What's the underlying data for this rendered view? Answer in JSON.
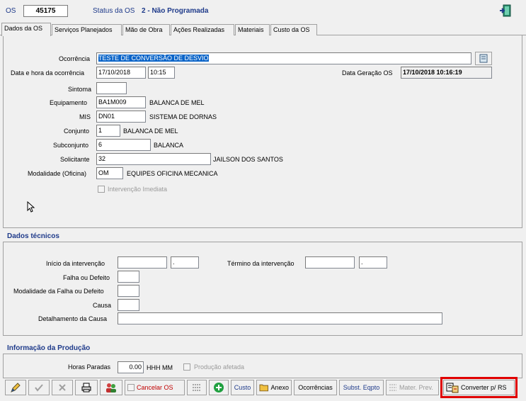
{
  "header": {
    "os_label": "OS",
    "os_number": "45175",
    "status_label": "Status da OS",
    "status_value": "2 - Não Programada"
  },
  "tabs": [
    {
      "label": "Dados da OS",
      "active": true
    },
    {
      "label": "Serviços Planejados",
      "active": false
    },
    {
      "label": "Mão de Obra",
      "active": false
    },
    {
      "label": "Ações Realizadas",
      "active": false
    },
    {
      "label": "Materiais",
      "active": false
    },
    {
      "label": "Custo da OS",
      "active": false
    }
  ],
  "form": {
    "ocorrencia_label": "Ocorrência",
    "ocorrencia_value": "TESTE DE CONVERSÃO DE DESVIO",
    "data_hora_label": "Data e hora da ocorrência",
    "data_value": "17/10/2018",
    "hora_value": "10:15",
    "data_geracao_label": "Data Geração OS",
    "data_geracao_value": "17/10/2018 10:16:19",
    "sintoma_label": "Sintoma",
    "sintoma_value": "",
    "equipamento_label": "Equipamento",
    "equipamento_code": "BA1M009",
    "equipamento_desc": "BALANCA DE MEL",
    "mis_label": "MIS",
    "mis_code": "DN01",
    "mis_desc": "SISTEMA DE DORNAS",
    "conjunto_label": "Conjunto",
    "conjunto_code": "1",
    "conjunto_desc": "BALANCA DE MEL",
    "subconjunto_label": "Subconjunto",
    "subconjunto_code": "6",
    "subconjunto_desc": "BALANCA",
    "solicitante_label": "Solicitante",
    "solicitante_code": "32",
    "solicitante_desc": "JAILSON DOS SANTOS",
    "modalidade_label": "Modalidade (Oficina)",
    "modalidade_code": "OM",
    "modalidade_desc": "EQUIPES OFICINA MECANICA",
    "intervencao_imediata_label": "Intervenção Imediata"
  },
  "dados_tecnicos": {
    "title": "Dados técnicos",
    "inicio_label": "Início da intervenção",
    "inicio_date": "",
    "inicio_time": ".",
    "termino_label": "Término da intervenção",
    "termino_date": "",
    "termino_time": ".",
    "falha_label": "Falha ou Defeito",
    "modalidade_falha_label": "Modalidade da Falha ou Defeito",
    "causa_label": "Causa",
    "detalhamento_label": "Detalhamento da Causa"
  },
  "producao": {
    "title": "Informação da Produção",
    "horas_paradas_label": "Horas Paradas",
    "horas_paradas_value": "0.00",
    "unit": "HHH MM",
    "producao_afetada_label": "Produção afetada"
  },
  "toolbar": {
    "cancelar_label": "Cancelar OS",
    "custo_label": "Custo",
    "anexo_label": "Anexo",
    "ocorrencias_label": "Ocorrências",
    "subst_label": "Subst. Eqpto",
    "mater_label": "Mater. Prev.",
    "converter_label": "Converter p/ RS"
  }
}
